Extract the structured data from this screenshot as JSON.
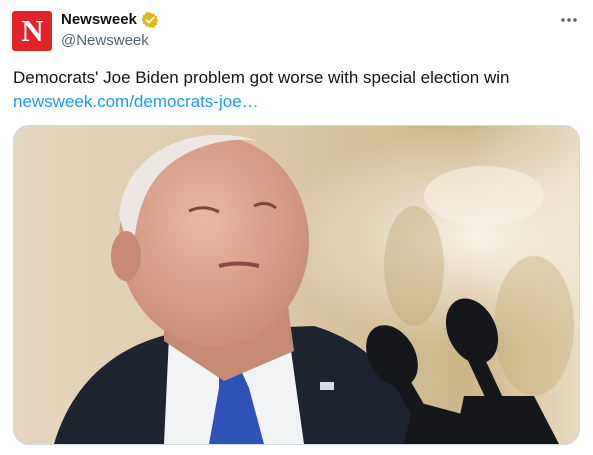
{
  "account": {
    "display_name": "Newsweek",
    "handle": "@Newsweek",
    "avatar_letter": "N",
    "avatar_color": "#e0242a",
    "verified_badge": "gold-verified-icon",
    "verified_color": "#e2b719"
  },
  "menu": {
    "icon": "more-horizontal-icon"
  },
  "tweet": {
    "text": "Democrats' Joe Biden problem got worse with special election win",
    "link_text": "newsweek.com/democrats-joe…",
    "link_color": "#1d9bf0"
  },
  "media": {
    "image_description_icon": "photo-of-speaker-at-microphones"
  }
}
